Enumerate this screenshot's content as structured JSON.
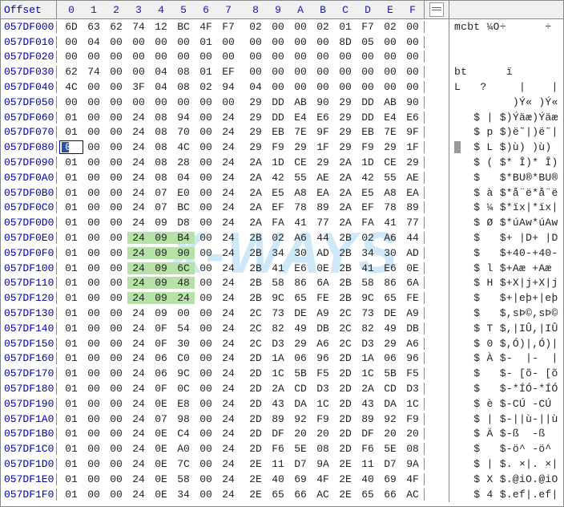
{
  "header": {
    "offset_label": "Offset",
    "columns": [
      "0",
      "1",
      "2",
      "3",
      "4",
      "5",
      "6",
      "7",
      "8",
      "9",
      "A",
      "B",
      "C",
      "D",
      "E",
      "F"
    ]
  },
  "watermark": "X-WAYS",
  "cursor": {
    "row": 8,
    "col": 0
  },
  "rows": [
    {
      "offset": "057DF000",
      "hex": [
        "6D",
        "63",
        "62",
        "74",
        "12",
        "BC",
        "4F",
        "F7",
        "02",
        "00",
        "00",
        "02",
        "01",
        "F7",
        "02",
        "00"
      ],
      "ascii": "mcbt ¼O÷      ÷"
    },
    {
      "offset": "057DF010",
      "hex": [
        "00",
        "04",
        "00",
        "00",
        "00",
        "00",
        "01",
        "00",
        "00",
        "00",
        "00",
        "00",
        "8D",
        "05",
        "00",
        "00"
      ],
      "ascii": ""
    },
    {
      "offset": "057DF020",
      "hex": [
        "00",
        "00",
        "00",
        "00",
        "00",
        "00",
        "00",
        "00",
        "00",
        "00",
        "00",
        "00",
        "00",
        "00",
        "00",
        "00"
      ],
      "ascii": ""
    },
    {
      "offset": "057DF030",
      "hex": [
        "62",
        "74",
        "00",
        "00",
        "04",
        "08",
        "01",
        "EF",
        "00",
        "00",
        "00",
        "00",
        "00",
        "00",
        "00",
        "00"
      ],
      "ascii": "bt      ï"
    },
    {
      "offset": "057DF040",
      "hex": [
        "4C",
        "00",
        "00",
        "3F",
        "04",
        "08",
        "02",
        "94",
        "04",
        "00",
        "00",
        "00",
        "00",
        "00",
        "00",
        "00"
      ],
      "ascii": "L   ?     |    |"
    },
    {
      "offset": "057DF050",
      "hex": [
        "00",
        "00",
        "00",
        "00",
        "00",
        "00",
        "00",
        "00",
        "29",
        "DD",
        "AB",
        "90",
        "29",
        "DD",
        "AB",
        "90"
      ],
      "ascii": "         )Ý« )Ý«"
    },
    {
      "offset": "057DF060",
      "hex": [
        "01",
        "00",
        "00",
        "24",
        "08",
        "94",
        "00",
        "24",
        "29",
        "DD",
        "E4",
        "E6",
        "29",
        "DD",
        "E4",
        "E6"
      ],
      "ascii": "   $ | $)Ýäæ)Ýäæ"
    },
    {
      "offset": "057DF070",
      "hex": [
        "01",
        "00",
        "00",
        "24",
        "08",
        "70",
        "00",
        "24",
        "29",
        "EB",
        "7E",
        "9F",
        "29",
        "EB",
        "7E",
        "9F"
      ],
      "ascii": "   $ p $)ë˜|)ë˜|"
    },
    {
      "offset": "057DF080",
      "hex": [
        "01",
        "00",
        "00",
        "24",
        "08",
        "4C",
        "00",
        "24",
        "29",
        "F9",
        "29",
        "1F",
        "29",
        "F9",
        "29",
        "1F"
      ],
      "ascii": "   $ L $)ù) )ù)"
    },
    {
      "offset": "057DF090",
      "hex": [
        "01",
        "00",
        "00",
        "24",
        "08",
        "28",
        "00",
        "24",
        "2A",
        "1D",
        "CE",
        "29",
        "2A",
        "1D",
        "CE",
        "29"
      ],
      "ascii": "   $ ( $* Î)* Î)"
    },
    {
      "offset": "057DF0A0",
      "hex": [
        "01",
        "00",
        "00",
        "24",
        "08",
        "04",
        "00",
        "24",
        "2A",
        "42",
        "55",
        "AE",
        "2A",
        "42",
        "55",
        "AE"
      ],
      "ascii": "   $   $*BU®*BU®"
    },
    {
      "offset": "057DF0B0",
      "hex": [
        "01",
        "00",
        "00",
        "24",
        "07",
        "E0",
        "00",
        "24",
        "2A",
        "E5",
        "A8",
        "EA",
        "2A",
        "E5",
        "A8",
        "EA"
      ],
      "ascii": "   $ à $*å¨ë*å¨ë"
    },
    {
      "offset": "057DF0C0",
      "hex": [
        "01",
        "00",
        "00",
        "24",
        "07",
        "BC",
        "00",
        "24",
        "2A",
        "EF",
        "78",
        "89",
        "2A",
        "EF",
        "78",
        "89"
      ],
      "ascii": "   $ ¼ $*ïx|*ïx|"
    },
    {
      "offset": "057DF0D0",
      "hex": [
        "01",
        "00",
        "00",
        "24",
        "09",
        "D8",
        "00",
        "24",
        "2A",
        "FA",
        "41",
        "77",
        "2A",
        "FA",
        "41",
        "77"
      ],
      "ascii": "   $ Ø $*úAw*úAw"
    },
    {
      "offset": "057DF0E0",
      "hex": [
        "01",
        "00",
        "00",
        "24",
        "09",
        "B4",
        "00",
        "24",
        "2B",
        "02",
        "A6",
        "44",
        "2B",
        "02",
        "A6",
        "44"
      ],
      "ascii": "   $   $+ |D+ |D"
    },
    {
      "offset": "057DF0F0",
      "hex": [
        "01",
        "00",
        "00",
        "24",
        "09",
        "90",
        "00",
        "24",
        "2B",
        "34",
        "30",
        "AD",
        "2B",
        "34",
        "30",
        "AD"
      ],
      "ascii": "   $   $+40-+40-"
    },
    {
      "offset": "057DF100",
      "hex": [
        "01",
        "00",
        "00",
        "24",
        "09",
        "6C",
        "00",
        "24",
        "2B",
        "41",
        "E6",
        "0E",
        "2B",
        "41",
        "E6",
        "0E"
      ],
      "ascii": "   $ l $+Aæ +Aæ"
    },
    {
      "offset": "057DF110",
      "hex": [
        "01",
        "00",
        "00",
        "24",
        "09",
        "48",
        "00",
        "24",
        "2B",
        "58",
        "86",
        "6A",
        "2B",
        "58",
        "86",
        "6A"
      ],
      "ascii": "   $ H $+X|j+X|j"
    },
    {
      "offset": "057DF120",
      "hex": [
        "01",
        "00",
        "00",
        "24",
        "09",
        "24",
        "00",
        "24",
        "2B",
        "9C",
        "65",
        "FE",
        "2B",
        "9C",
        "65",
        "FE"
      ],
      "ascii": "   $   $+|eþ+|eþ"
    },
    {
      "offset": "057DF130",
      "hex": [
        "01",
        "00",
        "00",
        "24",
        "09",
        "00",
        "00",
        "24",
        "2C",
        "73",
        "DE",
        "A9",
        "2C",
        "73",
        "DE",
        "A9"
      ],
      "ascii": "   $   $,sÞ©,sÞ©"
    },
    {
      "offset": "057DF140",
      "hex": [
        "01",
        "00",
        "00",
        "24",
        "0F",
        "54",
        "00",
        "24",
        "2C",
        "82",
        "49",
        "DB",
        "2C",
        "82",
        "49",
        "DB"
      ],
      "ascii": "   $ T $,|IÛ,|IÛ"
    },
    {
      "offset": "057DF150",
      "hex": [
        "01",
        "00",
        "00",
        "24",
        "0F",
        "30",
        "00",
        "24",
        "2C",
        "D3",
        "29",
        "A6",
        "2C",
        "D3",
        "29",
        "A6"
      ],
      "ascii": "   $ 0 $,Ó)|,Ó)|"
    },
    {
      "offset": "057DF160",
      "hex": [
        "01",
        "00",
        "00",
        "24",
        "06",
        "C0",
        "00",
        "24",
        "2D",
        "1A",
        "06",
        "96",
        "2D",
        "1A",
        "06",
        "96"
      ],
      "ascii": "   $ À $-  |-  |"
    },
    {
      "offset": "057DF170",
      "hex": [
        "01",
        "00",
        "00",
        "24",
        "06",
        "9C",
        "00",
        "24",
        "2D",
        "1C",
        "5B",
        "F5",
        "2D",
        "1C",
        "5B",
        "F5"
      ],
      "ascii": "   $   $- [õ- [õ"
    },
    {
      "offset": "057DF180",
      "hex": [
        "01",
        "00",
        "00",
        "24",
        "0F",
        "0C",
        "00",
        "24",
        "2D",
        "2A",
        "CD",
        "D3",
        "2D",
        "2A",
        "CD",
        "D3"
      ],
      "ascii": "   $   $-*ÍÓ-*ÍÓ"
    },
    {
      "offset": "057DF190",
      "hex": [
        "01",
        "00",
        "00",
        "24",
        "0E",
        "E8",
        "00",
        "24",
        "2D",
        "43",
        "DA",
        "1C",
        "2D",
        "43",
        "DA",
        "1C"
      ],
      "ascii": "   $ è $-CÚ -CÚ"
    },
    {
      "offset": "057DF1A0",
      "hex": [
        "01",
        "00",
        "00",
        "24",
        "07",
        "98",
        "00",
        "24",
        "2D",
        "89",
        "92",
        "F9",
        "2D",
        "89",
        "92",
        "F9"
      ],
      "ascii": "   $ | $-||ù-||ù"
    },
    {
      "offset": "057DF1B0",
      "hex": [
        "01",
        "00",
        "00",
        "24",
        "0E",
        "C4",
        "00",
        "24",
        "2D",
        "DF",
        "20",
        "20",
        "2D",
        "DF",
        "20",
        "20"
      ],
      "ascii": "   $ Ä $-ß  -ß"
    },
    {
      "offset": "057DF1C0",
      "hex": [
        "01",
        "00",
        "00",
        "24",
        "0E",
        "A0",
        "00",
        "24",
        "2D",
        "F6",
        "5E",
        "08",
        "2D",
        "F6",
        "5E",
        "08"
      ],
      "ascii": "   $   $-ö^ -ö^"
    },
    {
      "offset": "057DF1D0",
      "hex": [
        "01",
        "00",
        "00",
        "24",
        "0E",
        "7C",
        "00",
        "24",
        "2E",
        "11",
        "D7",
        "9A",
        "2E",
        "11",
        "D7",
        "9A"
      ],
      "ascii": "   $ | $. ×|. ×|"
    },
    {
      "offset": "057DF1E0",
      "hex": [
        "01",
        "00",
        "00",
        "24",
        "0E",
        "58",
        "00",
        "24",
        "2E",
        "40",
        "69",
        "4F",
        "2E",
        "40",
        "69",
        "4F"
      ],
      "ascii": "   $ X $.@iO.@iO"
    },
    {
      "offset": "057DF1F0",
      "hex": [
        "01",
        "00",
        "00",
        "24",
        "0E",
        "34",
        "00",
        "24",
        "2E",
        "65",
        "66",
        "AC",
        "2E",
        "65",
        "66",
        "AC"
      ],
      "ascii": "   $ 4 $.ef|.ef|"
    }
  ],
  "green_cols": {
    "start": 3,
    "end": 5,
    "row_start": 14,
    "row_end": 18
  },
  "chart_data": null
}
